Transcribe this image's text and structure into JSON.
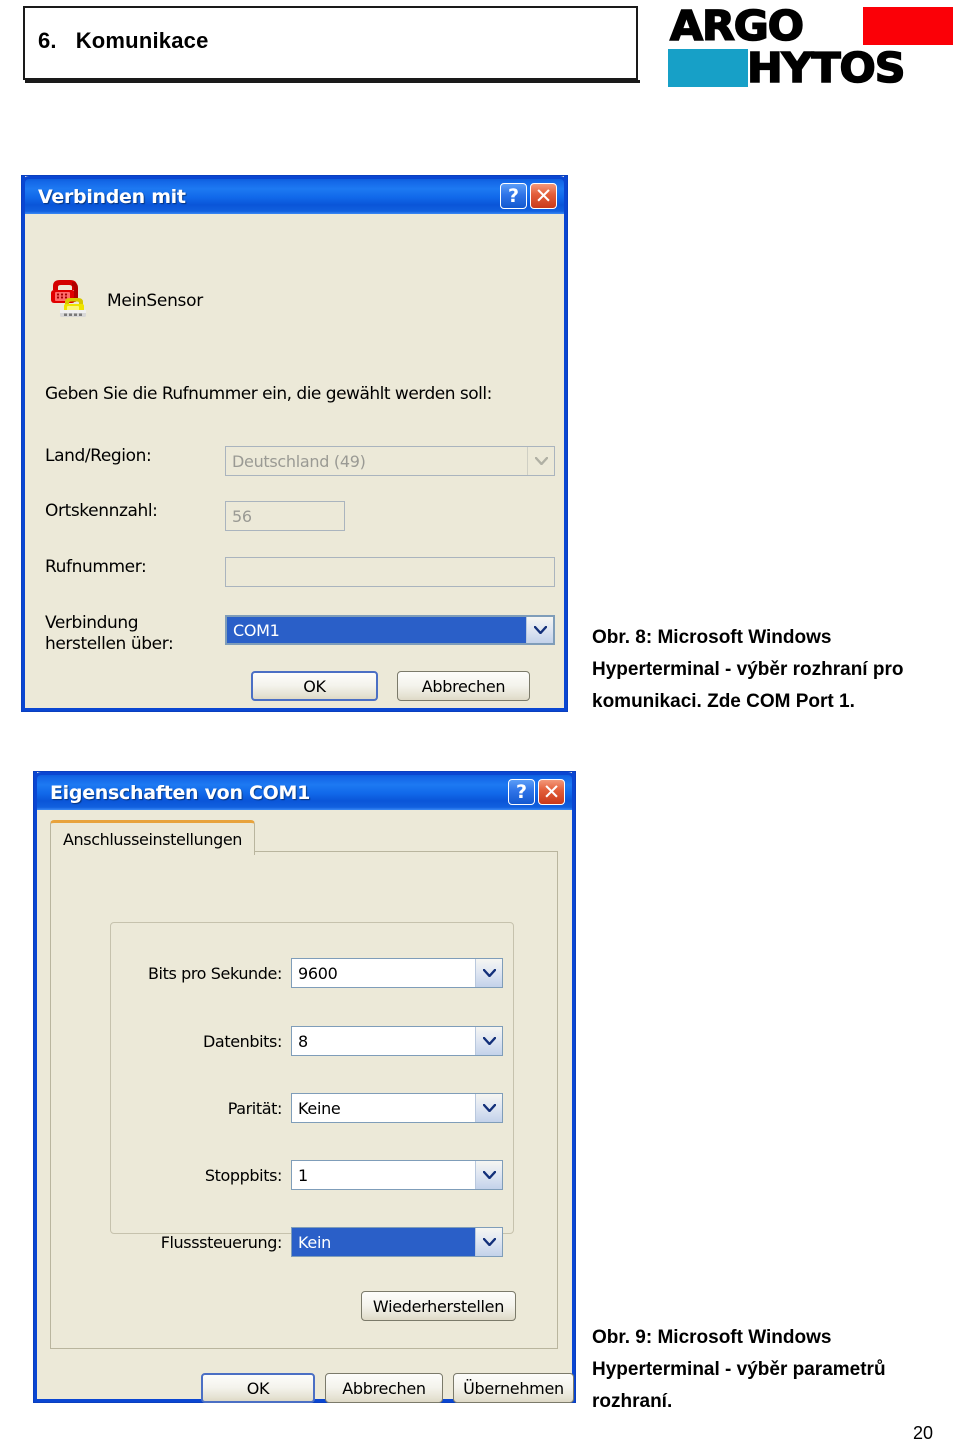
{
  "header": {
    "chapter_number": "6.",
    "chapter_title": "Komunikace",
    "logo": {
      "word_top": "ARGO",
      "word_bottom": "HYTOS",
      "red_hex": "#FB0007",
      "cyan_hex": "#17A0C7"
    }
  },
  "dialog_connect": {
    "title": "Verbinden mit",
    "help_button": "?",
    "close_button": "✕",
    "connection_name": "MeinSensor",
    "instruction": "Geben Sie die Rufnummer ein, die gewählt werden soll:",
    "fields": [
      {
        "label": "Land/Region:",
        "value": "Deutschland (49)",
        "type": "combo",
        "state": "disabled"
      },
      {
        "label": "Ortskennzahl:",
        "value": "56",
        "type": "text",
        "state": "disabled"
      },
      {
        "label": "Rufnummer:",
        "value": "",
        "type": "text",
        "state": "disabled"
      },
      {
        "label": "Verbindung\nherstellen über:",
        "value": "COM1",
        "type": "combo",
        "state": "selected"
      }
    ],
    "buttons": {
      "ok": "OK",
      "cancel": "Abbrechen"
    }
  },
  "dialog_properties": {
    "title": "Eigenschaften von COM1",
    "help_button": "?",
    "close_button": "✕",
    "tab_label": "Anschlusseinstellungen",
    "settings": [
      {
        "label": "Bits pro Sekunde:",
        "value": "9600",
        "state": "normal"
      },
      {
        "label": "Datenbits:",
        "value": "8",
        "state": "normal"
      },
      {
        "label": "Parität:",
        "value": "Keine",
        "state": "normal"
      },
      {
        "label": "Stoppbits:",
        "value": "1",
        "state": "normal"
      },
      {
        "label": "Flusssteuerung:",
        "value": "Kein",
        "state": "selected"
      }
    ],
    "restore_button": "Wiederherstellen",
    "buttons": {
      "ok": "OK",
      "cancel": "Abbrechen",
      "apply": "Übernehmen"
    }
  },
  "captions": {
    "fig8": "Obr. 8: Microsoft Windows Hyperterminal - výběr rozhraní pro komunikaci. Zde COM Port 1.",
    "fig9": "Obr. 9: Microsoft Windows Hyperterminal - výběr parametrů rozhraní."
  },
  "page_number": "20"
}
